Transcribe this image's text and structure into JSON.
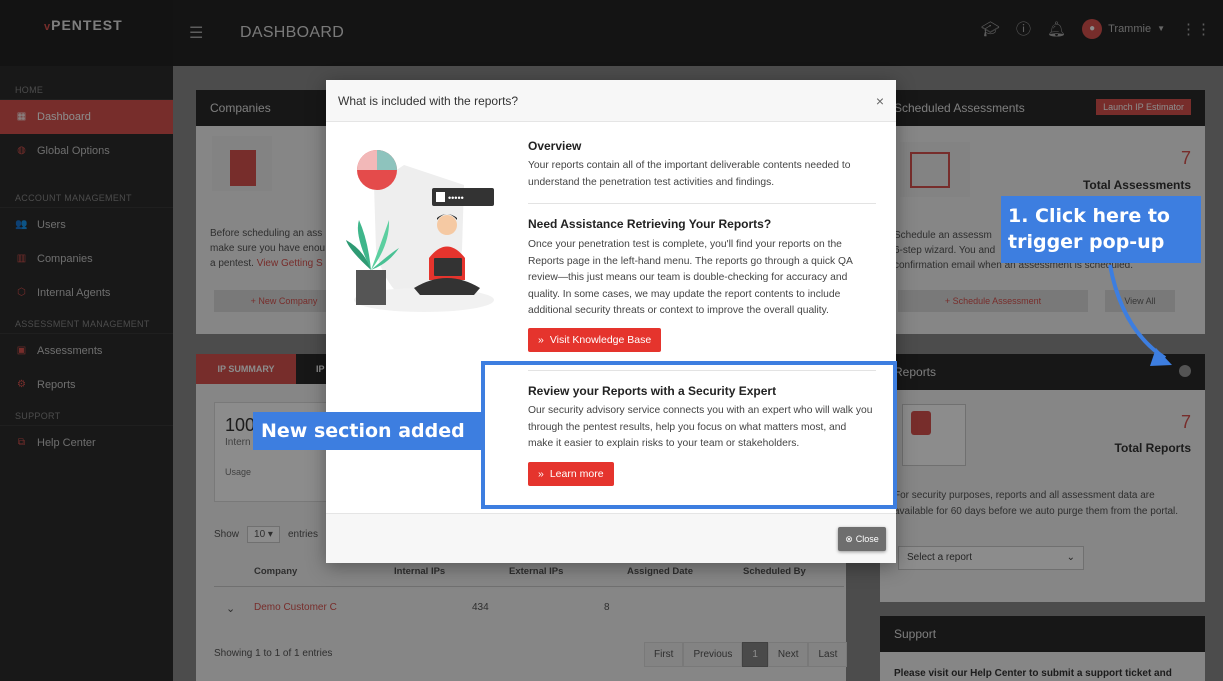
{
  "app": {
    "logo_prefix": "v",
    "logo_text": "PENTEST",
    "page_title": "DASHBOARD"
  },
  "topbar": {
    "user_name": "Trammie"
  },
  "sidebar": {
    "sections": [
      {
        "label": "HOME",
        "items": [
          {
            "label": "Dashboard",
            "icon": "grid-icon",
            "active": true
          },
          {
            "label": "Global Options",
            "icon": "globe-icon"
          }
        ]
      },
      {
        "label": "ACCOUNT MANAGEMENT",
        "items": [
          {
            "label": "Users",
            "icon": "users-icon"
          },
          {
            "label": "Companies",
            "icon": "building-icon"
          },
          {
            "label": "Internal Agents",
            "icon": "cube-icon"
          }
        ]
      },
      {
        "label": "ASSESSMENT MANAGEMENT",
        "items": [
          {
            "label": "Assessments",
            "icon": "calendar-icon"
          },
          {
            "label": "Reports",
            "icon": "gear-icon"
          }
        ]
      },
      {
        "label": "SUPPORT",
        "items": [
          {
            "label": "Help Center",
            "icon": "help-icon"
          }
        ]
      }
    ]
  },
  "background": {
    "companies": {
      "title": "Companies",
      "text": "Before scheduling an ass",
      "text2": "make sure you have enou",
      "text3": "a pentest.",
      "link": "View Getting S",
      "btn": "+ New Company"
    },
    "scheduled": {
      "title": "Scheduled Assessments",
      "launch_btn": "Launch IP Estimator",
      "count": "7",
      "count_label": "Total Assessments",
      "text1": "Schedule an assessm",
      "text2": "6-step wizard. You and",
      "text3": "confirmation email when an assessment is scheduled.",
      "btn": "+ Schedule Assessment",
      "view_all": "View All"
    },
    "ip_summary": {
      "tab1": "IP SUMMARY",
      "tab2": "IP",
      "big_number": "100",
      "sub": "Intern",
      "usage": "Usage"
    },
    "table": {
      "show": "Show",
      "show_count": "10",
      "entries": "entries",
      "headers": [
        "Company",
        "Internal IPs",
        "External IPs",
        "Assigned Date",
        "Scheduled By"
      ],
      "row": [
        "Demo Customer C",
        "434",
        "8"
      ],
      "footer": "Showing 1 to 1 of 1 entries",
      "pager": [
        "First",
        "Previous",
        "1",
        "Next",
        "Last"
      ]
    },
    "reports": {
      "title": "Reports",
      "count": "7",
      "count_label": "Total Reports",
      "text": "For security purposes, reports and all assessment data are available for 60 days before we auto purge them from the portal.",
      "select": "Select a report"
    },
    "support": {
      "title": "Support",
      "text": "Please visit our Help Center to submit a support ticket and"
    }
  },
  "modal": {
    "title": "What is included with the reports?",
    "overview_title": "Overview",
    "overview_text": "Your reports contain all of the important deliverable contents needed to understand the penetration test activities and findings.",
    "assist_title": "Need Assistance Retrieving Your Reports?",
    "assist_text": "Once your penetration test is complete, you'll find your reports on the Reports page in the left-hand menu. The reports go through a quick QA review—this just means our team is double-checking for accuracy and quality. In some cases, we may update the report contents to include additional security threats or context to improve the overall quality.",
    "kb_btn": "Visit Knowledge Base",
    "review_title": "Review your Reports with a Security Expert",
    "review_text": "Our security advisory service connects you with an expert who will walk you through the pentest results, help you focus on what matters most, and make it easier to explain risks to your team or stakeholders.",
    "learn_btn": "Learn more",
    "close_btn": "Close",
    "password_dots": "•••••"
  },
  "annotations": {
    "new_section": "New section added",
    "click_here_1": "1. Click here to",
    "click_here_2": "trigger pop-up"
  },
  "colors": {
    "accent": "#d9534f",
    "annotation_blue": "#3d7ee0"
  }
}
